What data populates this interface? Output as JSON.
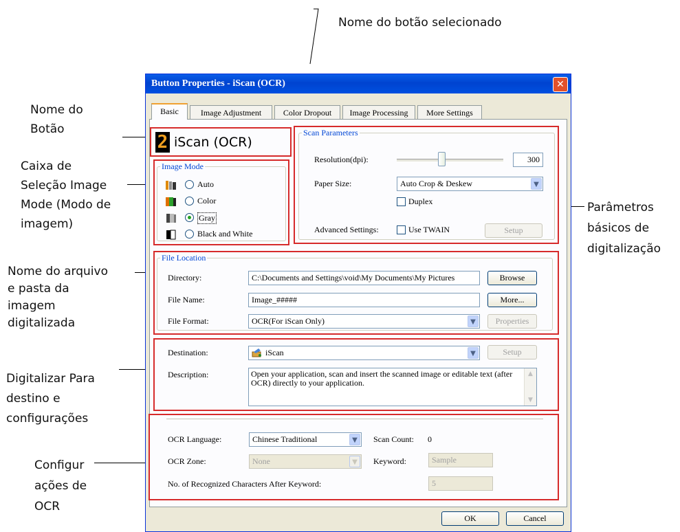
{
  "annotations": {
    "selected_button_name": "Nome do botão selecionado",
    "button_name": "Nome do\nBotão",
    "image_mode_box": "Caixa de\nSeleção Image\nMode (Modo de\nimagem)",
    "file_folder": "Nome do arquivo\ne pasta da\nimagem\ndigitalizada",
    "destination_settings": "Digitalizar Para\ndestino e\nconfigurações",
    "ocr_settings": "Configur\nações de\nOCR",
    "scan_parameters": "Parâmetros\nbásicos de\ndigitalização"
  },
  "dialog": {
    "title": "Button Properties - iScan (OCR)",
    "close": "✕",
    "tabs": [
      "Basic",
      "Image Adjustment",
      "Color Dropout",
      "Image Processing",
      "More Settings"
    ],
    "button_number": "2",
    "button_name": "iScan (OCR)"
  },
  "image_mode": {
    "label": "Image Mode",
    "options": [
      "Auto",
      "Color",
      "Gray",
      "Black and White"
    ],
    "selected": "Gray"
  },
  "scan_parameters": {
    "label": "Scan Parameters",
    "resolution_label": "Resolution(dpi):",
    "resolution_value": "300",
    "paper_size_label": "Paper Size:",
    "paper_size_value": "Auto Crop & Deskew",
    "duplex_label": "Duplex",
    "advanced_label": "Advanced Settings:",
    "use_twain_label": "Use TWAIN",
    "setup_label": "Setup"
  },
  "file_location": {
    "label": "File Location",
    "directory_label": "Directory:",
    "directory_value": "C:\\Documents and Settings\\void\\My Documents\\My Pictures",
    "browse_label": "Browse",
    "file_name_label": "File Name:",
    "file_name_value": "Image_#####",
    "more_label": "More...",
    "file_format_label": "File Format:",
    "file_format_value": "OCR(For iScan Only)",
    "properties_label": "Properties"
  },
  "destination": {
    "destination_label": "Destination:",
    "destination_value": "iScan",
    "setup_label": "Setup",
    "description_label": "Description:",
    "description_text": "Open your application, scan and insert the scanned image or editable text (after OCR) directly to your application."
  },
  "ocr": {
    "language_label": "OCR Language:",
    "language_value": "Chinese Traditional",
    "scan_count_label": "Scan Count:",
    "scan_count_value": "0",
    "zone_label": "OCR Zone:",
    "zone_value": "None",
    "keyword_label": "Keyword:",
    "keyword_value": "Sample",
    "recognized_label": "No. of Recognized Characters After Keyword:",
    "recognized_value": "5"
  },
  "footer": {
    "ok_label": "OK",
    "cancel_label": "Cancel"
  }
}
